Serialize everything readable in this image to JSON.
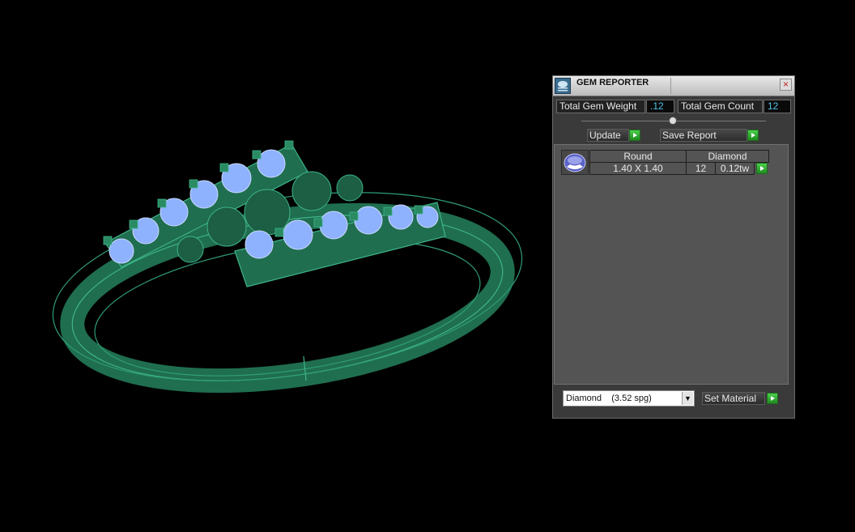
{
  "panel": {
    "title": "GEM REPORTER",
    "close_glyph": "×",
    "total_gem_weight_label": "Total Gem Weight",
    "total_gem_weight_value": ".12",
    "total_gem_count_label": "Total Gem Count",
    "total_gem_count_value": "12",
    "update_label": "Update",
    "save_report_label": "Save Report",
    "gem_rows": [
      {
        "shape": "Round",
        "material": "Diamond",
        "size": "1.40 X 1.40",
        "count": "12",
        "weight": "0.12tw"
      }
    ],
    "material_select_value": "Diamond    (3.52 spg)",
    "select_arrow_glyph": "▼",
    "set_material_label": "Set Material"
  },
  "icons": {
    "app": "gem-reporter-icon",
    "close": "close-icon",
    "go": "green-arrow-icon",
    "gem": "round-gem-icon"
  },
  "colors": {
    "ring_metal": "#1f6e4f",
    "gem_blue": "#8fb2ff",
    "value_text": "#4fc1e8",
    "go_button": "#2aa52a"
  }
}
